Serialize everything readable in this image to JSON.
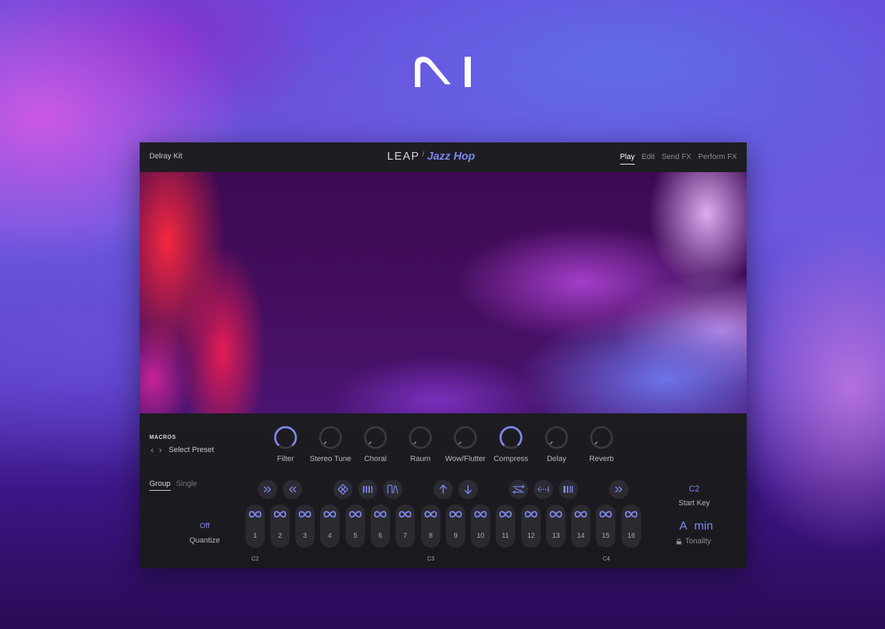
{
  "header": {
    "preset_name": "Delray Kit",
    "logo_leap": "LEAP",
    "logo_kit": "Jazz Hop",
    "tabs": [
      {
        "label": "Play",
        "active": true
      },
      {
        "label": "Edit",
        "active": false
      },
      {
        "label": "Send FX",
        "active": false
      },
      {
        "label": "Perform FX",
        "active": false
      }
    ]
  },
  "macros": {
    "title": "MACROS",
    "preset_selector": "Select Preset",
    "knobs": [
      {
        "label": "Filter",
        "value": 1.0,
        "active": true
      },
      {
        "label": "Stereo Tune",
        "value": 0.0,
        "active": false
      },
      {
        "label": "Choral",
        "value": 0.0,
        "active": false
      },
      {
        "label": "Raum",
        "value": 0.0,
        "active": false
      },
      {
        "label": "Wow/Flutter",
        "value": 0.0,
        "active": false
      },
      {
        "label": "Compress",
        "value": 1.0,
        "active": true
      },
      {
        "label": "Delay",
        "value": 0.0,
        "active": false
      },
      {
        "label": "Reverb",
        "value": 0.0,
        "active": false
      }
    ]
  },
  "mode": {
    "group_label": "Group",
    "single_label": "Single",
    "selected": "Group"
  },
  "quantize": {
    "value": "Off",
    "label": "Quantize"
  },
  "fx_buttons": [
    "fast-forward-icon",
    "rewind-icon",
    "grid-diamond-icon",
    "stutter-bars-icon",
    "envelope-filter-icon",
    "pitch-up-icon",
    "pitch-down-icon",
    "swap-icon",
    "reverse-icon",
    "gate-bars-icon",
    "skip-forward-icon"
  ],
  "pads": [
    "1",
    "2",
    "3",
    "4",
    "5",
    "6",
    "7",
    "8",
    "9",
    "10",
    "11",
    "12",
    "13",
    "14",
    "15",
    "16"
  ],
  "octave_labels": {
    "c2": "C2",
    "c3": "C3",
    "c4": "C4"
  },
  "start_key": {
    "value": "C2",
    "label": "Start Key"
  },
  "tonality": {
    "root": "A",
    "scale": "min",
    "label": "Tonality"
  },
  "colors": {
    "accent": "#7f87ee",
    "panel": "#1c1b20"
  }
}
